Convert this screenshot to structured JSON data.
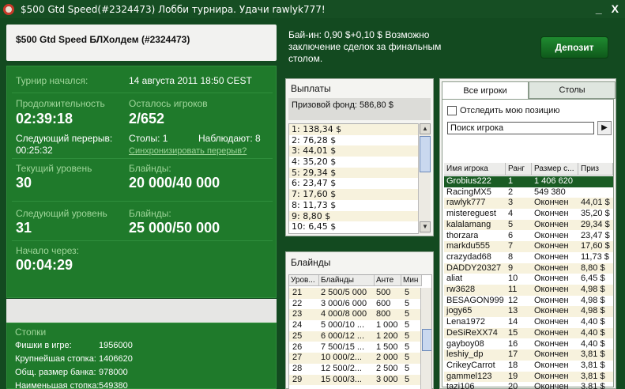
{
  "window": {
    "title": "$500 Gtd Speed(#2324473) Лобби турнира. Удачи rawlyk777!",
    "minimize": "_",
    "close": "X"
  },
  "tournament": {
    "name": "$500 Gtd Speed БЛХолдем (#2324473)",
    "started_label": "Турнир начался:",
    "started_value": "14 августа 2011  18:50 CEST",
    "duration_label": "Продолжительность",
    "duration_value": "02:39:18",
    "players_left_label": "Осталось игроков",
    "players_left_value": "2/652",
    "next_break_label": "Следующий перерыв:",
    "next_break_value": "00:25:32",
    "tables_label": "Столы: 1",
    "observers_label": "Наблюдают: 8",
    "sync_breaks_link": "Синхронизировать перерыв?",
    "current_level_label": "Текущий уровень",
    "current_level_value": "30",
    "blinds_label": "Блайнды:",
    "current_blinds_value": "20 000/40 000",
    "next_level_label": "Следующий уровень",
    "next_level_value": "31",
    "next_blinds_label": "Блайнды:",
    "next_blinds_value": "25 000/50 000",
    "starts_in_label": "Начало через:",
    "starts_in_value": "00:04:29"
  },
  "stacks": {
    "title": "Стопки",
    "rows": [
      {
        "label": "Фишки в игре:",
        "value": "1956000"
      },
      {
        "label": "Крупнейшая стопка:",
        "value": "1406620"
      },
      {
        "label": "Общ. размер банка:",
        "value": "978000"
      },
      {
        "label": "Наименьшая стопка:",
        "value": "549380"
      }
    ]
  },
  "buyin": {
    "text": "Бай-ин: 0,90 $+0,10 $ Возможно заключение сделок за финальным столом.",
    "deposit_button": "Депозит"
  },
  "payouts": {
    "title": "Выплаты",
    "prize_fund": "Призовой фонд: 586,80 $",
    "items": [
      "1: 138,34 $",
      "2: 76,28 $",
      "3: 44,01 $",
      "4: 35,20 $",
      "5: 29,34 $",
      "6: 23,47 $",
      "7: 17,60 $",
      "8: 11,73 $",
      "9: 8,80 $",
      "10: 6,45 $"
    ]
  },
  "blinds": {
    "title": "Блайнды",
    "columns": [
      "Уров...",
      "Блайнды",
      "Анте",
      "Мин"
    ],
    "rows": [
      [
        "21",
        "2 500/5 000",
        "500",
        "5"
      ],
      [
        "22",
        "3 000/6 000",
        "600",
        "5"
      ],
      [
        "23",
        "4 000/8 000",
        "800",
        "5"
      ],
      [
        "24",
        "5 000/10 ...",
        "1 000",
        "5"
      ],
      [
        "25",
        "6 000/12 ...",
        "1 200",
        "5"
      ],
      [
        "26",
        "7 500/15 ...",
        "1 500",
        "5"
      ],
      [
        "27",
        "10 000/2...",
        "2 000",
        "5"
      ],
      [
        "28",
        "12 500/2...",
        "2 500",
        "5"
      ],
      [
        "29",
        "15 000/3...",
        "3 000",
        "5"
      ]
    ]
  },
  "players": {
    "tab_all": "Все игроки",
    "tab_tables": "Столы",
    "track_label": "Отследить мою позицию",
    "search_placeholder": "Поиск игрока",
    "search_go": "▶",
    "columns": [
      "Имя игрока",
      "Ранг",
      "Размер с...",
      "Приз"
    ],
    "rows": [
      [
        "Grobius222",
        "1",
        "1 406 620",
        ""
      ],
      [
        "RacingMX5",
        "2",
        "549 380",
        ""
      ],
      [
        "rawlyk777",
        "3",
        "Окончен",
        "44,01 $"
      ],
      [
        "mistereguest",
        "4",
        "Окончен",
        "35,20 $"
      ],
      [
        "kalalamang",
        "5",
        "Окончен",
        "29,34 $"
      ],
      [
        "thorzara",
        "6",
        "Окончен",
        "23,47 $"
      ],
      [
        "markdu555",
        "7",
        "Окончен",
        "17,60 $"
      ],
      [
        "crazydad68",
        "8",
        "Окончен",
        "11,73 $"
      ],
      [
        "DADDY20327",
        "9",
        "Окончен",
        "8,80 $"
      ],
      [
        "aliat",
        "10",
        "Окончен",
        "6,45 $"
      ],
      [
        "rw3628",
        "11",
        "Окончен",
        "4,98 $"
      ],
      [
        "BESAGON999",
        "12",
        "Окончен",
        "4,98 $"
      ],
      [
        "jogy65",
        "13",
        "Окончен",
        "4,98 $"
      ],
      [
        "Lena1972",
        "14",
        "Окончен",
        "4,40 $"
      ],
      [
        "DeSiReXX74",
        "15",
        "Окончен",
        "4,40 $"
      ],
      [
        "gayboy08",
        "16",
        "Окончен",
        "4,40 $"
      ],
      [
        "leshiy_dp",
        "17",
        "Окончен",
        "3,81 $"
      ],
      [
        "CrikeyCarrot",
        "18",
        "Окончен",
        "3,81 $"
      ],
      [
        "gammel123",
        "19",
        "Окончен",
        "3,81 $"
      ],
      [
        "tazi106",
        "20",
        "Окончен",
        "3,81 $"
      ]
    ]
  }
}
